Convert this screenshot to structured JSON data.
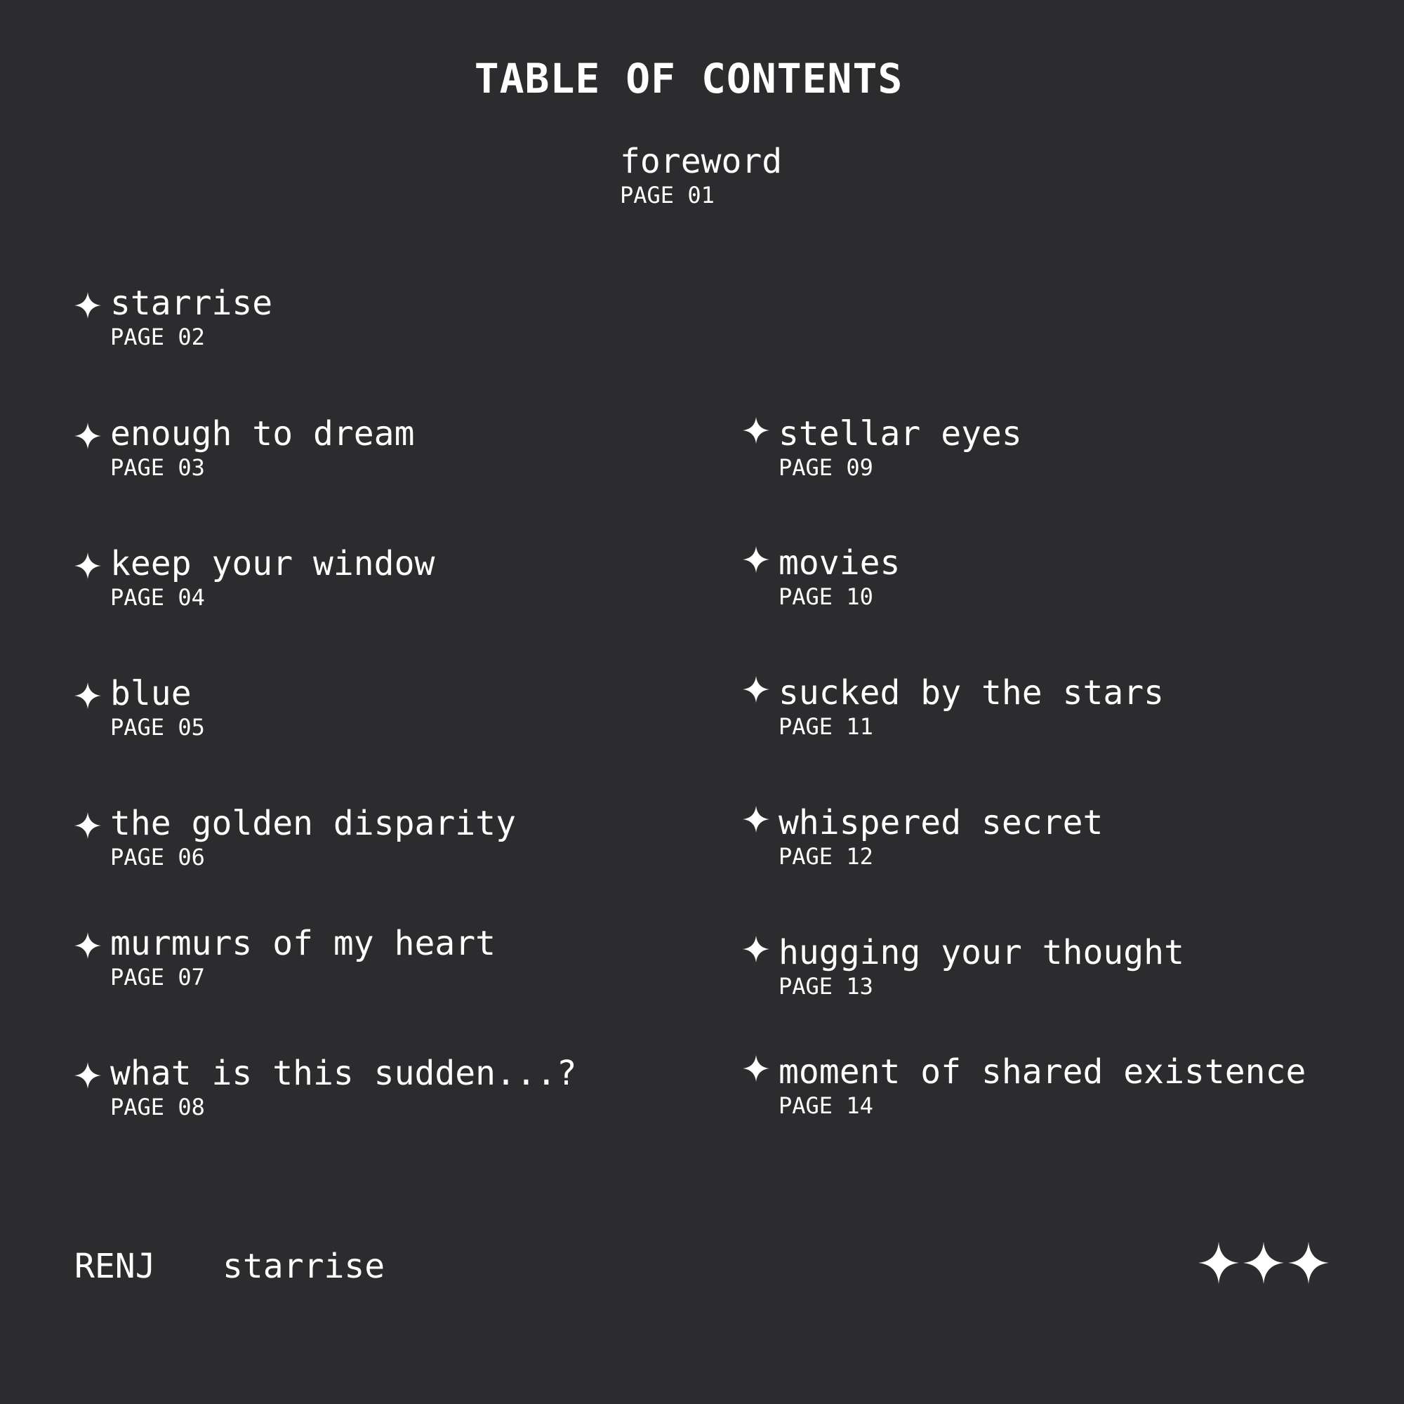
{
  "title": "TABLE OF CONTENTS",
  "foreword": {
    "name": "foreword",
    "page": "PAGE 01"
  },
  "left_entries": [
    {
      "name": "starrise",
      "page": "PAGE 02"
    },
    {
      "name": "enough to dream",
      "page": "PAGE 03"
    },
    {
      "name": "keep your window",
      "page": "PAGE 04"
    },
    {
      "name": "blue",
      "page": "PAGE 05"
    },
    {
      "name": "the golden disparity",
      "page": "PAGE 06"
    },
    {
      "name": "murmurs of my heart",
      "page": "PAGE 07"
    },
    {
      "name": "what is this sudden...?",
      "page": "PAGE 08"
    }
  ],
  "right_entries": [
    {
      "name": "stellar eyes",
      "page": "PAGE 09"
    },
    {
      "name": "movies",
      "page": "PAGE 10"
    },
    {
      "name": "sucked by the stars",
      "page": "PAGE 11"
    },
    {
      "name": "whispered secret",
      "page": "PAGE 12"
    },
    {
      "name": "hugging your thought",
      "page": "PAGE 13"
    },
    {
      "name": "moment of shared existence",
      "page": "PAGE 14"
    }
  ],
  "footer": {
    "author": "RENJ",
    "brand": "starrise",
    "decoration_icon": "three-sparkle-stars-icon"
  },
  "colors": {
    "background": "#2c2c2e",
    "text": "#ffffff"
  },
  "icons": {
    "bullet": "sparkle-star-icon"
  }
}
